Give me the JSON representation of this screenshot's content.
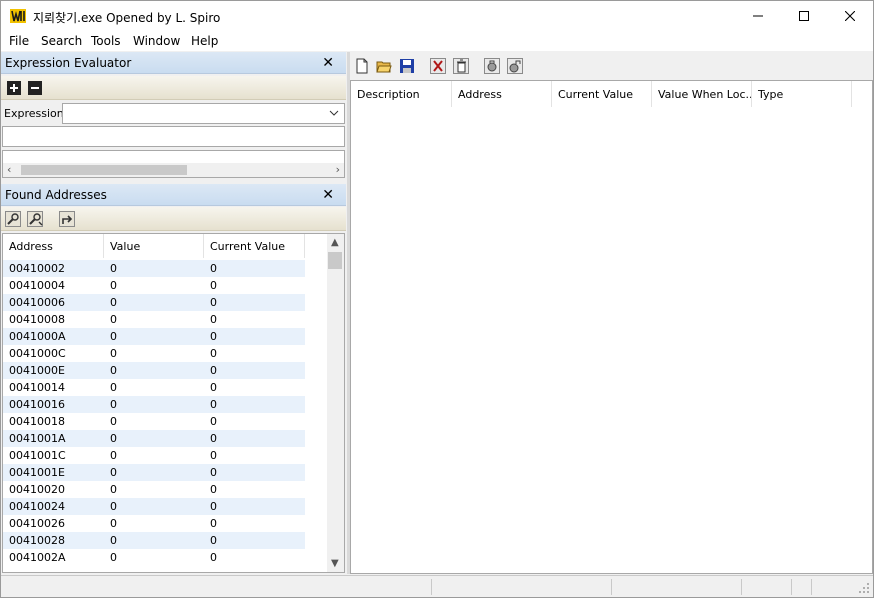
{
  "window": {
    "title": "지뢰찾기.exe Opened by L. Spiro",
    "icon": "app-logo-icon"
  },
  "menu": [
    "File",
    "Search",
    "Tools",
    "Window",
    "Help"
  ],
  "expression_evaluator": {
    "title": "Expression Evaluator",
    "close": "✕",
    "expression_label": "Expression:",
    "expression_value": "",
    "result_value": ""
  },
  "found_addresses": {
    "title": "Found Addresses",
    "close": "✕",
    "columns": [
      "Address",
      "Value",
      "Current Value"
    ],
    "rows": [
      [
        "00410002",
        "0",
        "0"
      ],
      [
        "00410004",
        "0",
        "0"
      ],
      [
        "00410006",
        "0",
        "0"
      ],
      [
        "00410008",
        "0",
        "0"
      ],
      [
        "0041000A",
        "0",
        "0"
      ],
      [
        "0041000C",
        "0",
        "0"
      ],
      [
        "0041000E",
        "0",
        "0"
      ],
      [
        "00410014",
        "0",
        "0"
      ],
      [
        "00410016",
        "0",
        "0"
      ],
      [
        "00410018",
        "0",
        "0"
      ],
      [
        "0041001A",
        "0",
        "0"
      ],
      [
        "0041001C",
        "0",
        "0"
      ],
      [
        "0041001E",
        "0",
        "0"
      ],
      [
        "00410020",
        "0",
        "0"
      ],
      [
        "00410024",
        "0",
        "0"
      ],
      [
        "00410026",
        "0",
        "0"
      ],
      [
        "00410028",
        "0",
        "0"
      ],
      [
        "0041002A",
        "0",
        "0"
      ]
    ]
  },
  "main_list": {
    "columns": [
      "Description",
      "Address",
      "Current Value",
      "Value When Loc...",
      "Type"
    ]
  },
  "colors": {
    "pane_header": "#c9dcf0",
    "row_alt": "#e8f1fb"
  }
}
